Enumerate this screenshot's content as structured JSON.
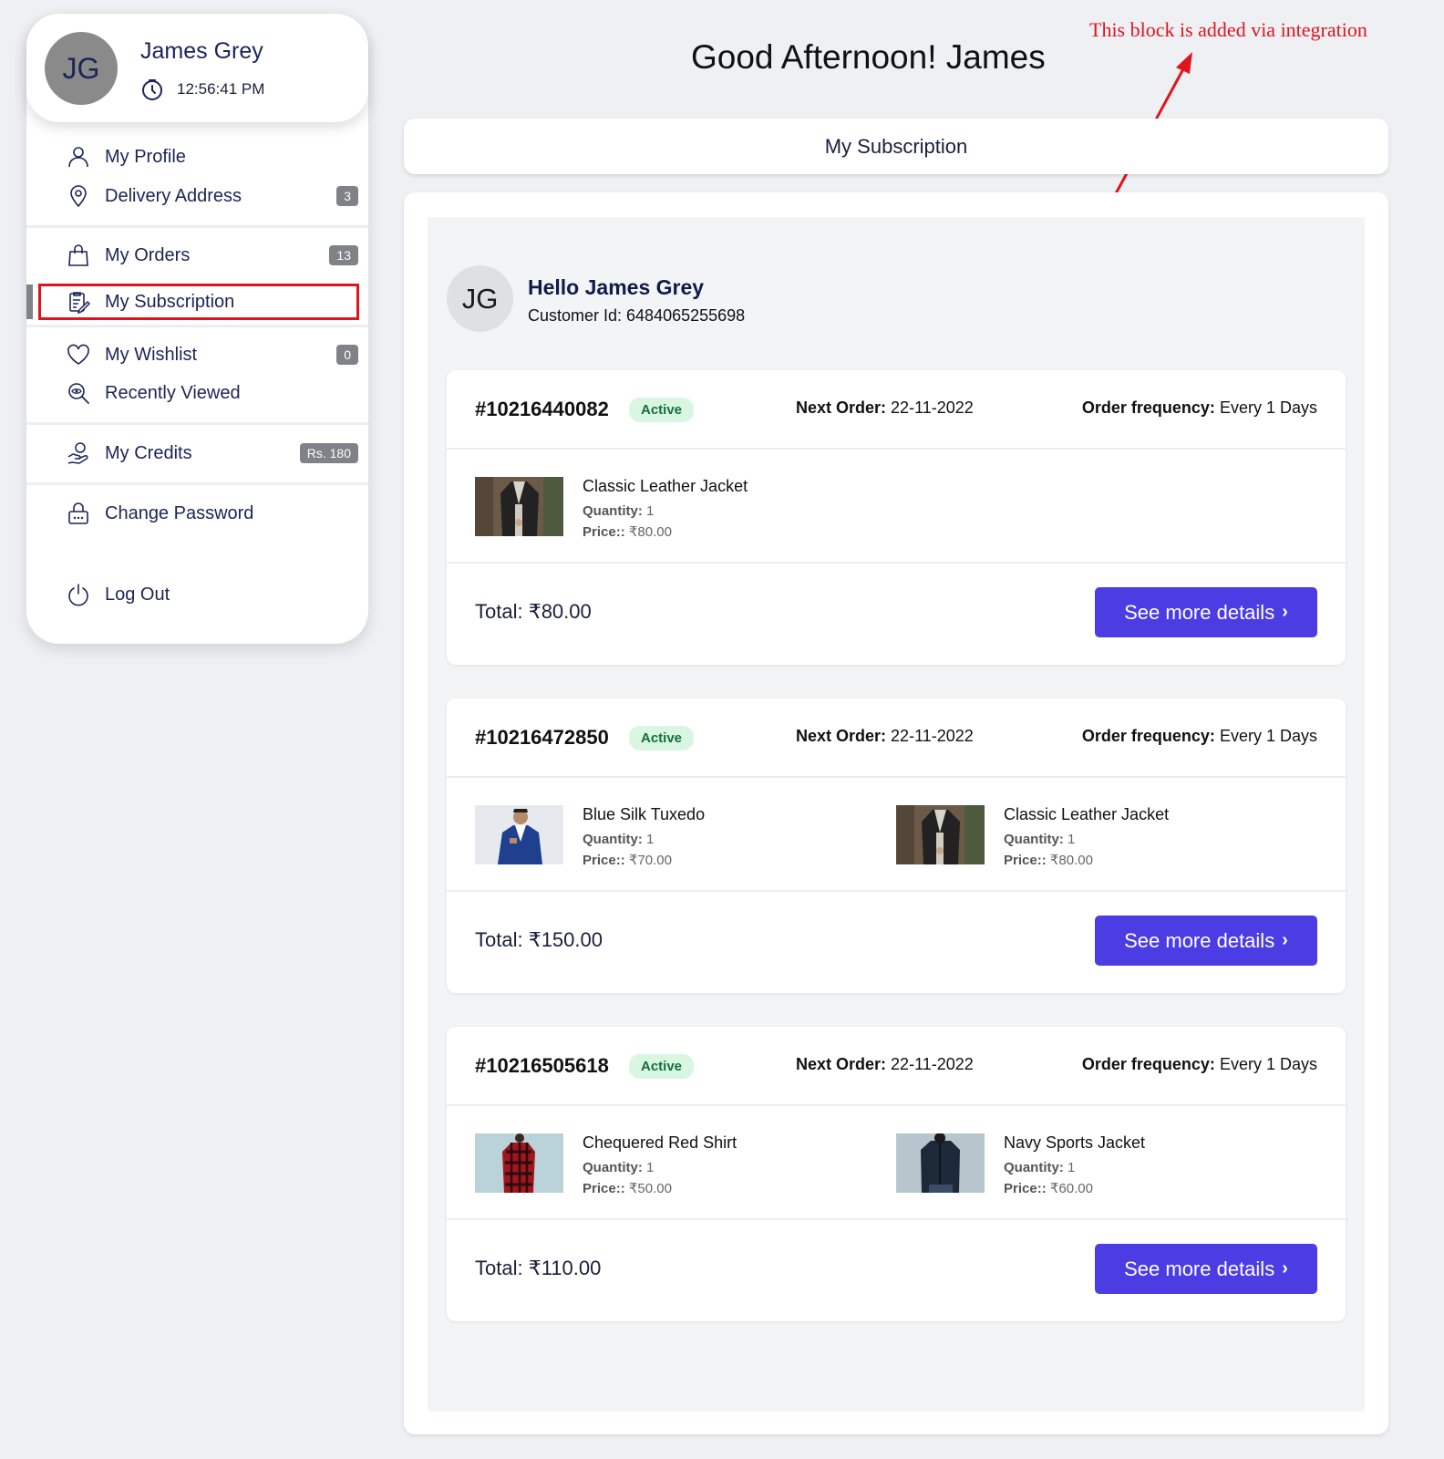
{
  "profile": {
    "initials": "JG",
    "name": "James Grey",
    "time": "12:56:41 PM"
  },
  "nav": {
    "profile": {
      "label": "My Profile",
      "icon": "user-icon"
    },
    "address": {
      "label": "Delivery Address",
      "icon": "location-pin-icon",
      "badge": "3"
    },
    "orders": {
      "label": "My Orders",
      "icon": "shopping-bag-icon",
      "badge": "13"
    },
    "subscription": {
      "label": "My Subscription",
      "icon": "clipboard-edit-icon"
    },
    "wishlist": {
      "label": "My Wishlist",
      "icon": "heart-icon",
      "badge": "0"
    },
    "recent": {
      "label": "Recently Viewed",
      "icon": "eye-search-icon"
    },
    "credits": {
      "label": "My Credits",
      "icon": "hand-coin-icon",
      "badge": "Rs. 180"
    },
    "password": {
      "label": "Change Password",
      "icon": "lock-icon"
    },
    "logout": {
      "label": "Log Out",
      "icon": "power-icon"
    }
  },
  "header": {
    "greeting": "Good Afternoon! James",
    "annotation": "This block is added via integration",
    "tab_title": "My Subscription"
  },
  "customer": {
    "initials": "JG",
    "hello": "Hello James Grey",
    "customer_id": "Customer Id: 6484065255698"
  },
  "labels": {
    "next_order": "Next Order:",
    "order_frequency": "Order frequency:",
    "quantity": "Quantity:",
    "price": "Price::",
    "see_more": "See more details"
  },
  "colors": {
    "accent": "#4b3de3",
    "active_badge_bg": "#d8f6e2",
    "annotation": "#e0141c"
  },
  "subscriptions": [
    {
      "id": "#10216440082",
      "status": "Active",
      "next_order": "22-11-2022",
      "frequency": "Every 1 Days",
      "items": [
        {
          "name": "Classic Leather Jacket",
          "qty": "1",
          "price": "₹80.00"
        }
      ],
      "total": "Total: ₹80.00"
    },
    {
      "id": "#10216472850",
      "status": "Active",
      "next_order": "22-11-2022",
      "frequency": "Every 1 Days",
      "items": [
        {
          "name": "Blue Silk Tuxedo",
          "qty": "1",
          "price": "₹70.00"
        },
        {
          "name": "Classic Leather Jacket",
          "qty": "1",
          "price": "₹80.00"
        }
      ],
      "total": "Total: ₹150.00"
    },
    {
      "id": "#10216505618",
      "status": "Active",
      "next_order": "22-11-2022",
      "frequency": "Every 1 Days",
      "items": [
        {
          "name": "Chequered Red Shirt",
          "qty": "1",
          "price": "₹50.00"
        },
        {
          "name": "Navy Sports Jacket",
          "qty": "1",
          "price": "₹60.00"
        }
      ],
      "total": "Total: ₹110.00"
    }
  ]
}
